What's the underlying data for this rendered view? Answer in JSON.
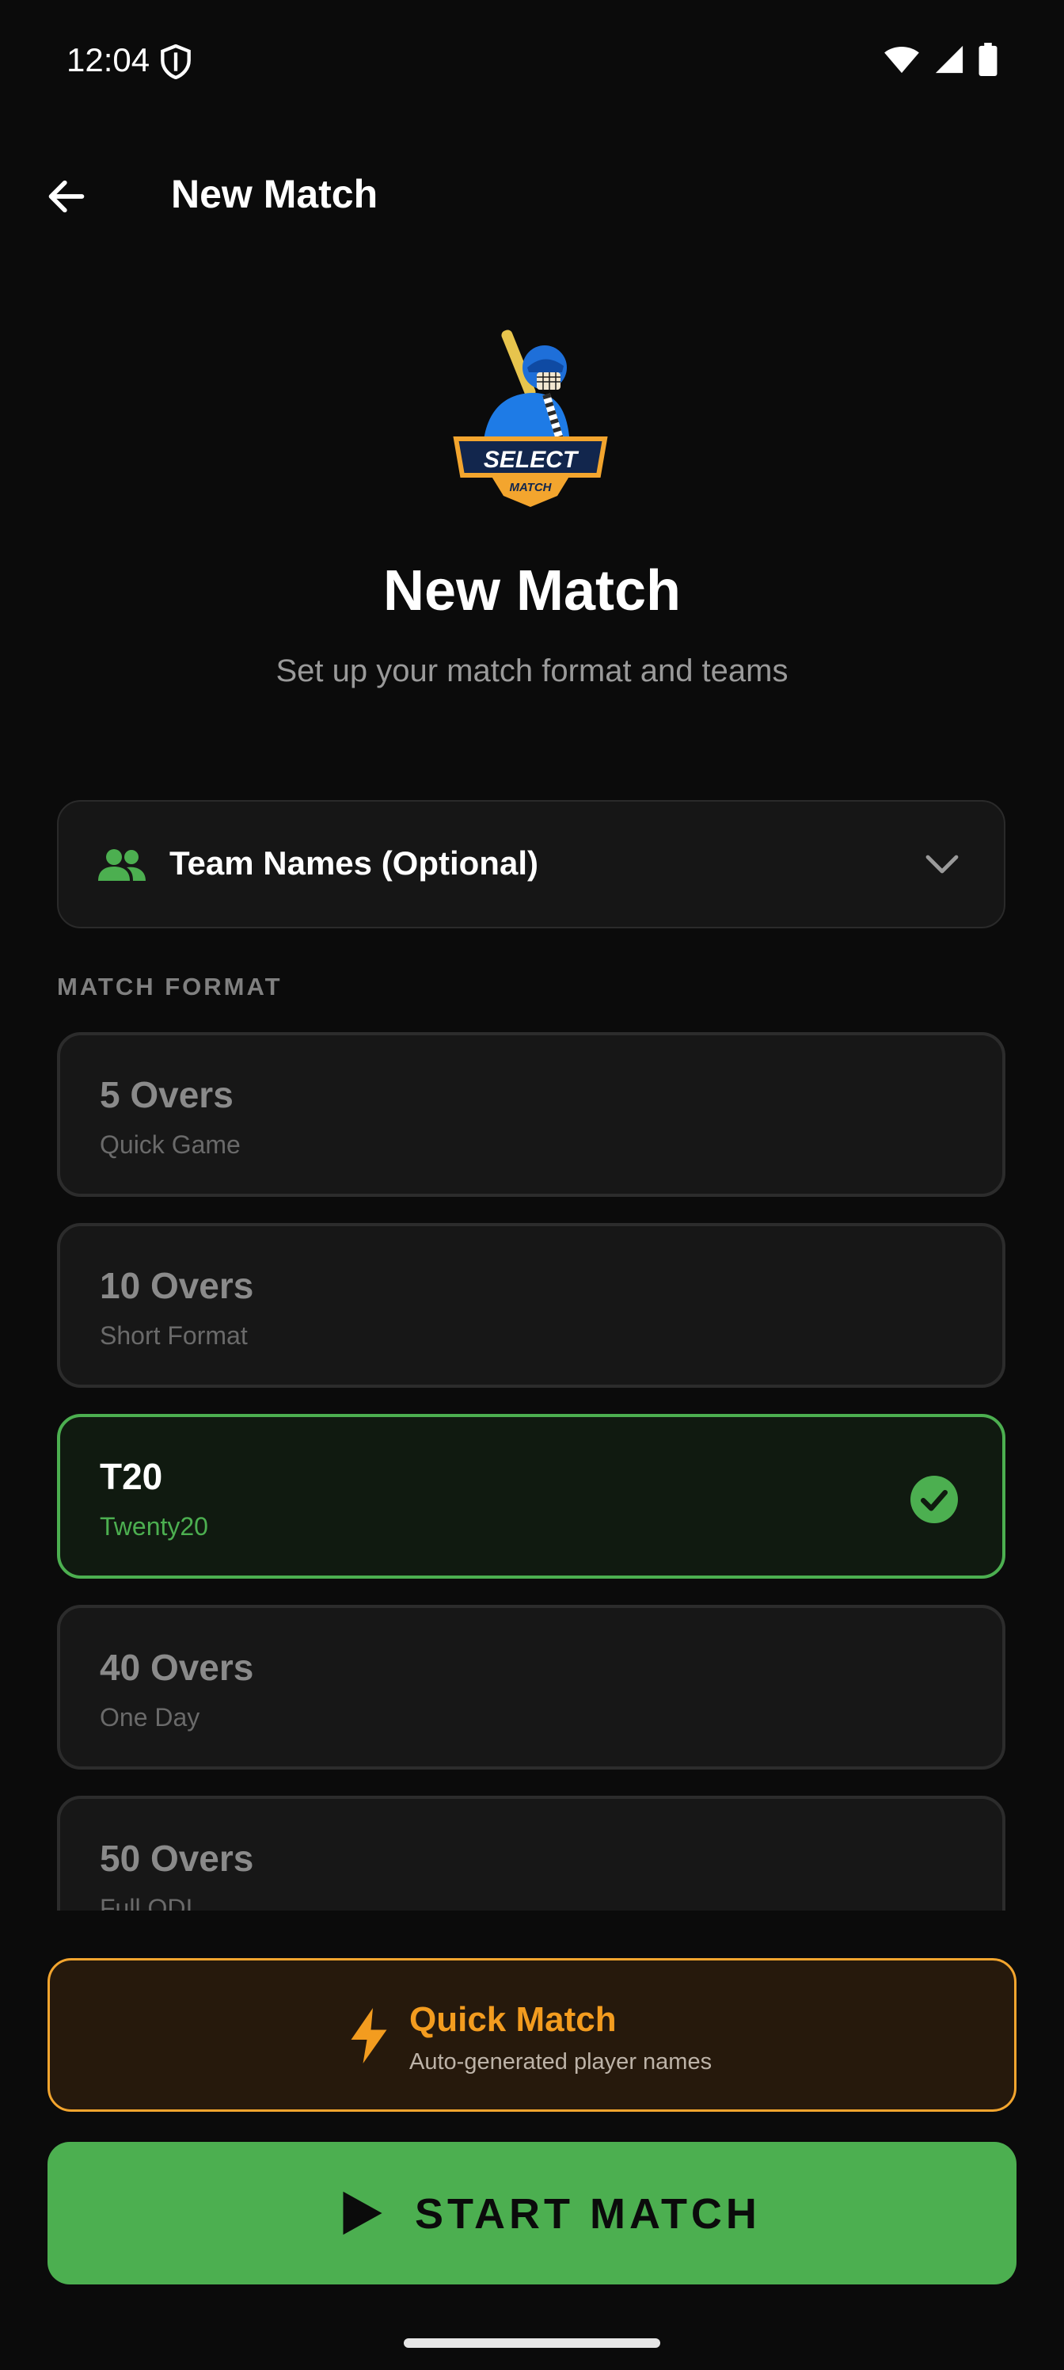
{
  "status_bar": {
    "time": "12:04"
  },
  "app_bar": {
    "title": "New Match"
  },
  "hero": {
    "title": "New Match",
    "subtitle": "Set up your match format and teams"
  },
  "logo": {
    "text_top": "SELECT",
    "text_bottom": "MATCH"
  },
  "team_names": {
    "label": "Team Names (Optional)"
  },
  "section": {
    "label": "MATCH FORMAT"
  },
  "formats": [
    {
      "title": "5 Overs",
      "subtitle": "Quick Game",
      "selected": false
    },
    {
      "title": "10 Overs",
      "subtitle": "Short Format",
      "selected": false
    },
    {
      "title": "T20",
      "subtitle": "Twenty20",
      "selected": true
    },
    {
      "title": "40 Overs",
      "subtitle": "One Day",
      "selected": false
    },
    {
      "title": "50 Overs",
      "subtitle": "Full ODI",
      "selected": false
    }
  ],
  "quick_match": {
    "title": "Quick Match",
    "subtitle": "Auto-generated player names"
  },
  "start_button": {
    "label": "START MATCH"
  },
  "colors": {
    "accent_green": "#4caf50",
    "accent_orange": "#f39c1f",
    "background": "#0b0b0b"
  },
  "icons": [
    "shield-icon",
    "wifi-icon",
    "signal-icon",
    "battery-icon",
    "back-arrow-icon",
    "team-icon",
    "chevron-down-icon",
    "check-circle-icon",
    "bolt-icon",
    "play-icon"
  ]
}
